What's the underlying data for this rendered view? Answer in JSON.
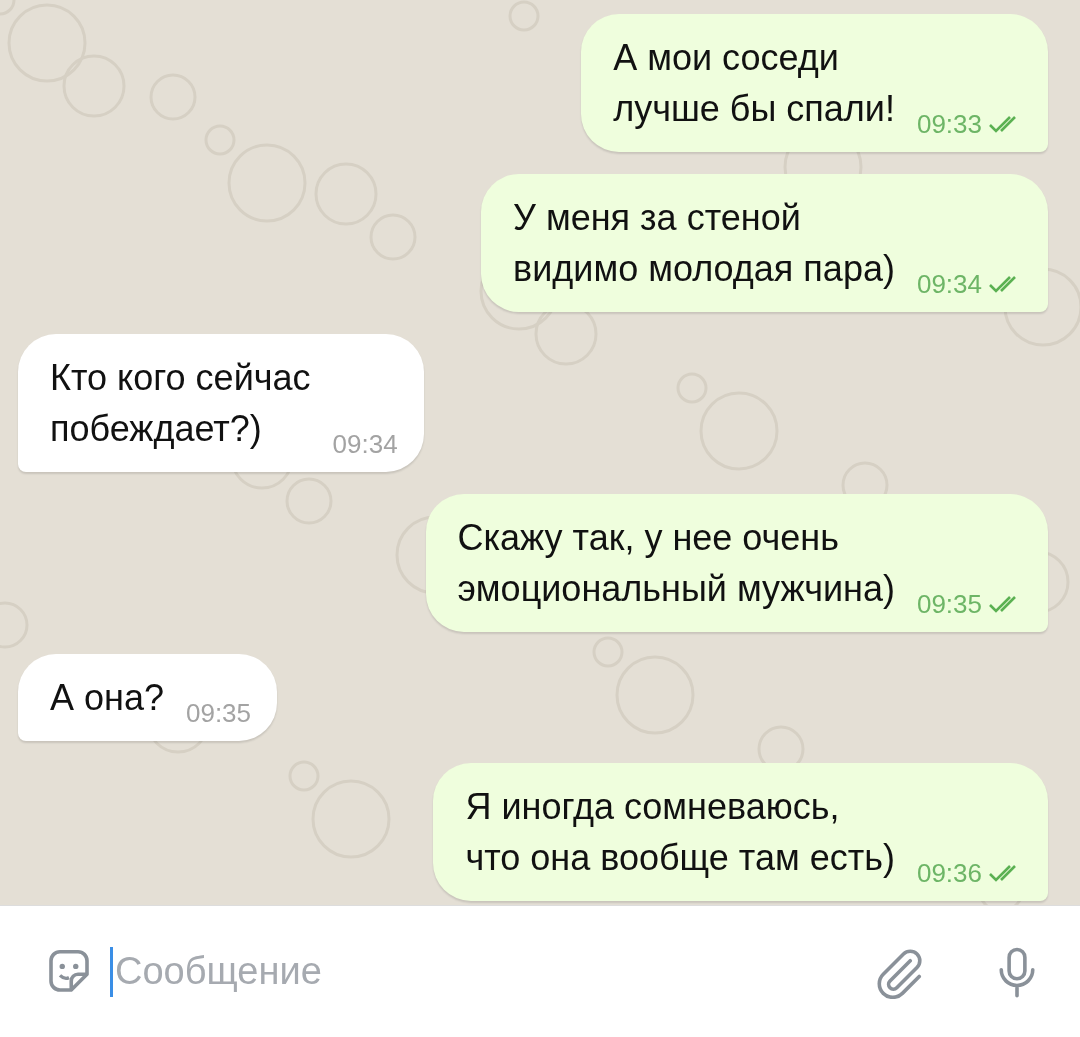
{
  "messages": [
    {
      "kind": "out",
      "lines": [
        "А мои соседи",
        "лучше бы спали!"
      ],
      "time": "09:33",
      "read": true
    },
    {
      "kind": "out",
      "lines": [
        "У меня за стеной",
        "видимо молодая пара)"
      ],
      "time": "09:34",
      "read": true
    },
    {
      "kind": "in",
      "lines": [
        "Кто кого сейчас",
        "побеждает?)"
      ],
      "time": "09:34"
    },
    {
      "kind": "out",
      "lines": [
        "Скажу так, у нее очень",
        "эмоциональный мужчина)"
      ],
      "time": "09:35",
      "read": true
    },
    {
      "kind": "in",
      "lines": [
        "А она?"
      ],
      "time": "09:35"
    },
    {
      "kind": "out",
      "lines": [
        "Я иногда сомневаюсь,",
        "что она вообще там есть)"
      ],
      "time": "09:36",
      "read": true
    }
  ],
  "composer": {
    "placeholder": "Сообщение"
  }
}
